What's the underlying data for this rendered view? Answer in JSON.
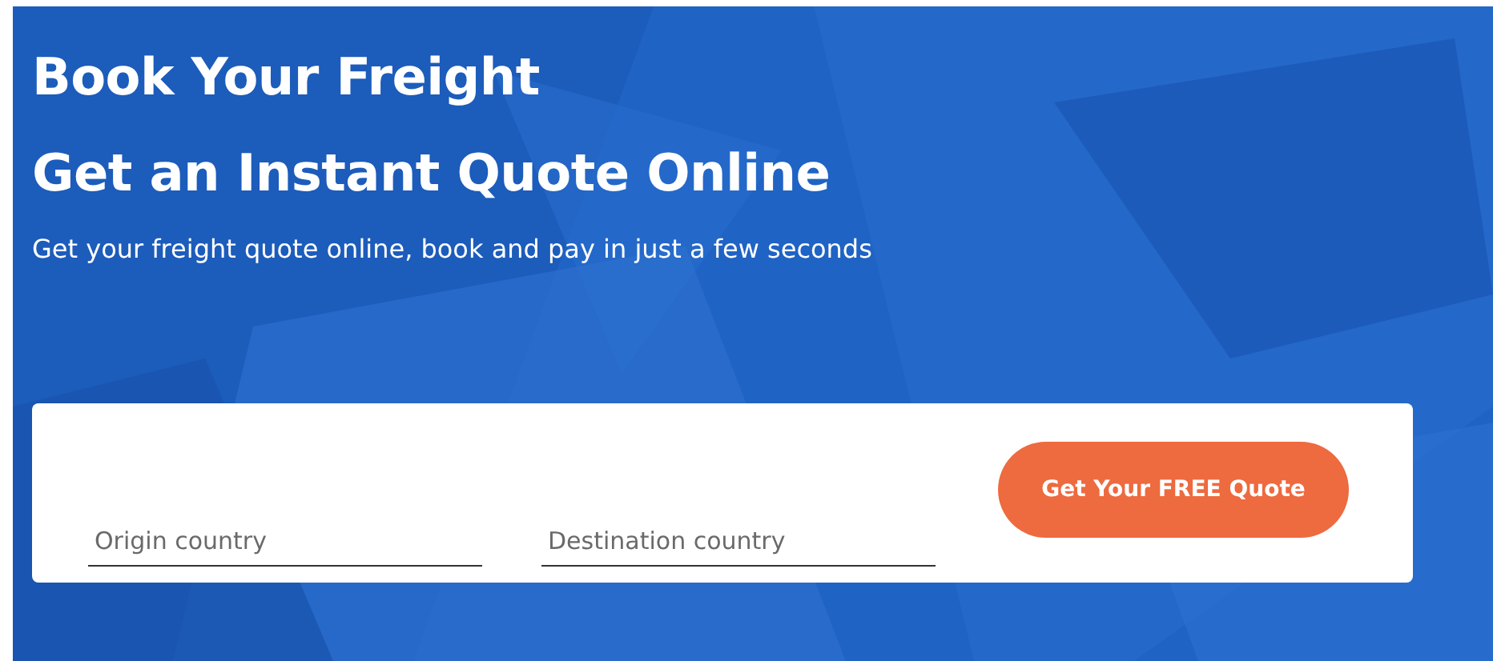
{
  "hero": {
    "title_lines": [
      "Book Your Freight",
      "Get an Instant Quote Online"
    ],
    "subtitle": "Get your freight quote online, book and pay in just a few seconds"
  },
  "quote_form": {
    "fields": [
      {
        "placeholder": "Origin country"
      },
      {
        "placeholder": "Destination country"
      }
    ],
    "button": "Get Your FREE Quote"
  }
}
